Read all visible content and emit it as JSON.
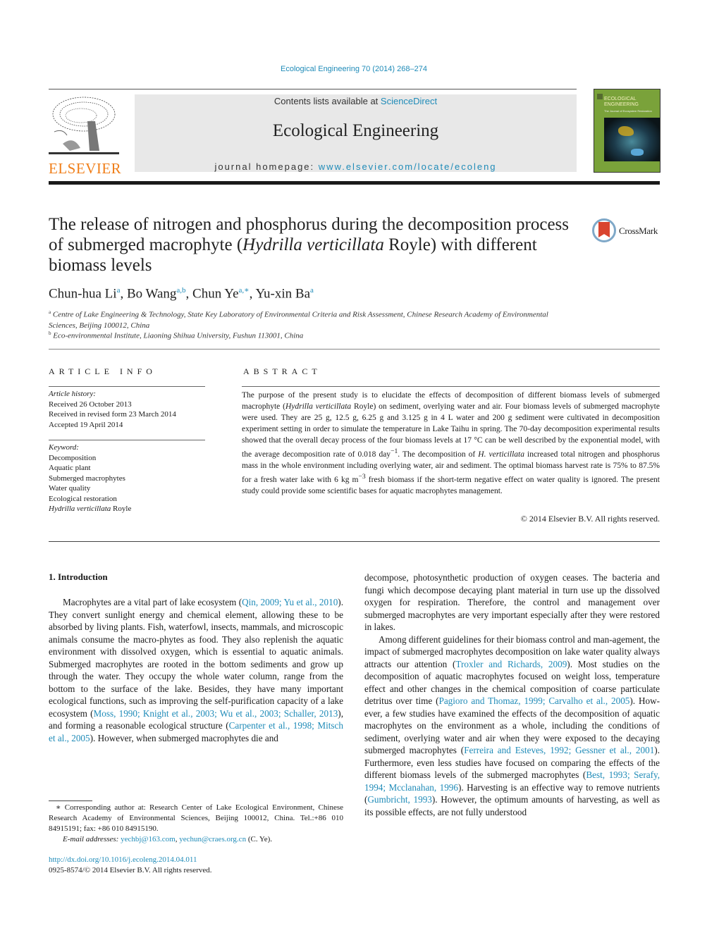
{
  "header": {
    "journal_ref": "Ecological Engineering 70 (2014) 268–274",
    "contents_prefix": "Contents lists available at ",
    "contents_link": "ScienceDirect",
    "journal_name": "Ecological Engineering",
    "homepage_prefix": "journal homepage: ",
    "homepage_link": "www.elsevier.com/locate/ecoleng",
    "publisher_logo_text": "ELSEVIER",
    "cover": {
      "title_line1": "ECOLOGICAL",
      "title_line2": "ENGINEERING",
      "subtitle": "The Journal of Ecosystem Restoration"
    },
    "colors": {
      "link": "#1f8bb8",
      "elsevier_orange": "#f07f1a",
      "banner_gray": "#e8e8e8"
    }
  },
  "article": {
    "title_part1": "The release of nitrogen and phosphorus during the decomposition process of submerged macrophyte (",
    "title_italic": "Hydrilla verticillata",
    "title_part2": " Royle) with different biomass levels",
    "crossmark_label": "CrossMark",
    "authors": [
      {
        "name": "Chun-hua Li",
        "sup": "a"
      },
      {
        "name": "Bo Wang",
        "sup": "a,b"
      },
      {
        "name": "Chun Ye",
        "sup": "a,∗"
      },
      {
        "name": "Yu-xin Ba",
        "sup": "a"
      }
    ],
    "affiliations": [
      {
        "label": "a",
        "text": "Centre of Lake Engineering & Technology, State Key Laboratory of Environmental Criteria and Risk Assessment, Chinese Research Academy of Environmental Sciences, Beijing 100012, China"
      },
      {
        "label": "b",
        "text": "Eco-environmental Institute, Liaoning Shihua University, Fushun 113001, China"
      }
    ]
  },
  "article_info": {
    "heading": "ARTICLE INFO",
    "history_label": "Article history:",
    "history": [
      "Received 26 October 2013",
      "Received in revised form 23 March 2014",
      "Accepted 19 April 2014"
    ],
    "keyword_label": "Keyword:",
    "keywords": [
      "Decomposition",
      "Aquatic plant",
      "Submerged macrophytes",
      "Water quality",
      "Ecological restoration"
    ],
    "last_keyword_italic": "Hydrilla verticillata",
    "last_keyword_rest": " Royle"
  },
  "abstract": {
    "heading": "ABSTRACT",
    "seg1": "The purpose of the present study is to elucidate the effects of decomposition of different biomass levels of submerged macrophyte (",
    "seg1_italic": "Hydrilla verticillata",
    "seg2": " Royle) on sediment, overlying water and air. Four biomass levels of submerged macrophyte were used. They are 25 g, 12.5 g, 6.25 g and 3.125 g in 4 L water and 200 g sediment were cultivated in decomposition experiment setting in order to simulate the temperature in Lake Taihu in spring. The 70-day decomposition experimental results showed that the overall decay process of the four biomass levels at 17 °C can be well described by the exponential model, with the average decomposition rate of 0.018 day",
    "seg2_sup": "−1",
    "seg3": ". The decomposition of ",
    "seg3_italic": "H. verticillata",
    "seg4": " increased total nitrogen and phosphorus mass in the whole environment including overlying water, air and sediment. The optimal biomass harvest rate is 75% to 87.5% for a fresh water lake with 6 kg m",
    "seg4_sup": "−3",
    "seg5": " fresh biomass if the short-term negative effect on water quality is ignored. The present study could provide some scientific bases for aquatic macrophytes management.",
    "copyright": "© 2014 Elsevier B.V. All rights reserved."
  },
  "introduction": {
    "heading": "1.  Introduction",
    "left_p1": [
      {
        "t": "Macrophytes are a vital part of lake ecosystem ("
      },
      {
        "t": "Qin, 2009; Yu et al., 2010",
        "link": true
      },
      {
        "t": "). They convert sunlight energy and chemical element, allowing these to be absorbed by living plants. Fish, waterfowl, insects, mammals, and microscopic animals consume the macro-phytes as food. They also replenish the aquatic environment with dissolved oxygen, which is essential to aquatic animals. Submerged macrophytes are rooted in the bottom sediments and grow up through the water. They occupy the whole water column, range from the bottom to the surface of the lake. Besides, they have many important ecological functions, such as improving the self-purification capacity of a lake ecosystem ("
      },
      {
        "t": "Moss, 1990; Knight et al., 2003; Wu et al., 2003; Schaller, 2013",
        "link": true
      },
      {
        "t": "), and forming a reasonable ecological structure ("
      },
      {
        "t": "Carpenter et al., 1998; Mitsch et al., 2005",
        "link": true
      },
      {
        "t": "). However, when submerged macrophytes die and"
      }
    ],
    "right_p1": "decompose, photosynthetic production of oxygen ceases. The bacteria and fungi which decompose decaying plant material in turn use up the dissolved oxygen for respiration. Therefore, the control and management over submerged macrophytes are very important especially after they were restored in lakes.",
    "right_p2": [
      {
        "t": "Among different guidelines for their biomass control and man-agement, the impact of submerged macrophytes decomposition on lake water quality always attracts our attention ("
      },
      {
        "t": "Troxler and Richards, 2009",
        "link": true
      },
      {
        "t": "). Most studies on the decomposition of aquatic macrophytes focused on weight loss, temperature effect and other changes in the chemical composition of coarse particulate detritus over time ("
      },
      {
        "t": "Pagioro and Thomaz, 1999; Carvalho et al., 2005",
        "link": true
      },
      {
        "t": "). How-ever, a few studies have examined the effects of the decomposition of aquatic macrophytes on the environment as a whole, including the conditions of sediment, overlying water and air when they were exposed to the decaying submerged macrophytes ("
      },
      {
        "t": "Ferreira and Esteves, 1992; Gessner et al., 2001",
        "link": true
      },
      {
        "t": "). Furthermore, even less studies have focused on comparing the effects of the different biomass levels of the submerged macrophytes ("
      },
      {
        "t": "Best, 1993; Serafy, 1994; Mcclanahan, 1996",
        "link": true
      },
      {
        "t": "). Harvesting is an effective way to remove nutrients ("
      },
      {
        "t": "Gumbricht, 1993",
        "link": true
      },
      {
        "t": "). However, the optimum amounts of harvesting, as well as its possible effects, are not fully understood"
      }
    ]
  },
  "footnote": {
    "corresponding": "∗  Corresponding author at: Research Center of Lake Ecological Environment, Chinese Research Academy of Environmental Sciences, Beijing 100012, China. Tel.:+86 010 84915191; fax: +86 010 84915190.",
    "email_label": "E-mail addresses:",
    "email1": "yechbj@163.com",
    "email2": "yechun@craes.org.cn",
    "email_suffix": " (C. Ye).",
    "doi": "http://dx.doi.org/10.1016/j.ecoleng.2014.04.011",
    "issn_copyright": "0925-8574/© 2014 Elsevier B.V. All rights reserved."
  }
}
